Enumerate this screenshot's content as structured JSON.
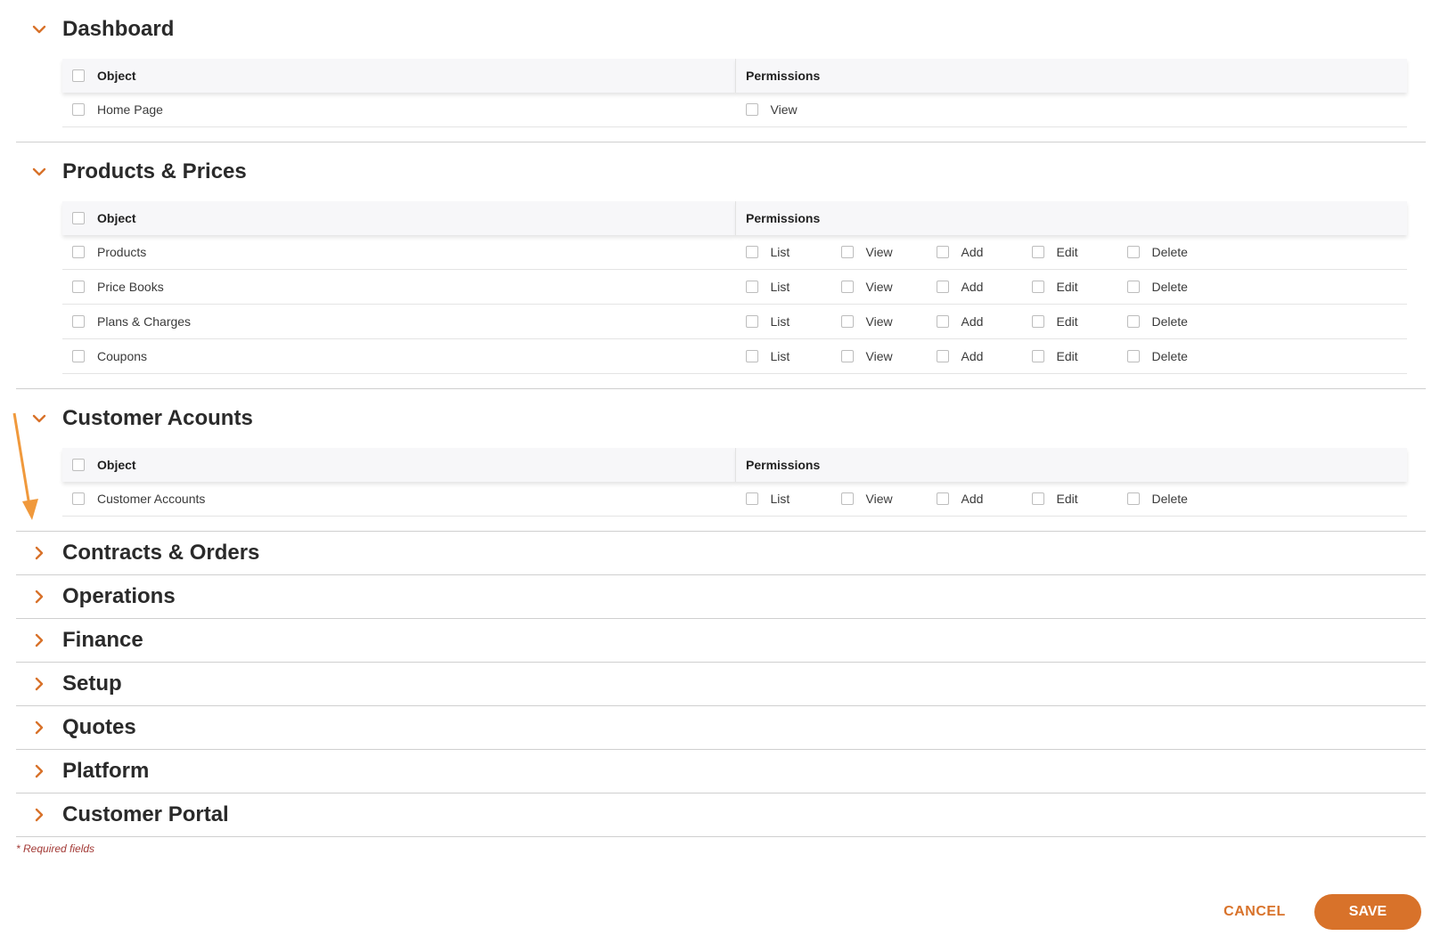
{
  "colors": {
    "accent": "#d8722a",
    "required": "#a33a36",
    "arrow": "#f0993c"
  },
  "table_headers": {
    "object": "Object",
    "permissions": "Permissions"
  },
  "sections": [
    {
      "title": "Dashboard",
      "expanded": true,
      "rows": [
        {
          "label": "Home Page",
          "permissions": [
            "View"
          ]
        }
      ]
    },
    {
      "title": "Products & Prices",
      "expanded": true,
      "rows": [
        {
          "label": "Products",
          "permissions": [
            "List",
            "View",
            "Add",
            "Edit",
            "Delete"
          ]
        },
        {
          "label": "Price Books",
          "permissions": [
            "List",
            "View",
            "Add",
            "Edit",
            "Delete"
          ]
        },
        {
          "label": "Plans & Charges",
          "permissions": [
            "List",
            "View",
            "Add",
            "Edit",
            "Delete"
          ]
        },
        {
          "label": "Coupons",
          "permissions": [
            "List",
            "View",
            "Add",
            "Edit",
            "Delete"
          ]
        }
      ]
    },
    {
      "title": "Customer Acounts",
      "expanded": true,
      "rows": [
        {
          "label": "Customer Accounts",
          "permissions": [
            "List",
            "View",
            "Add",
            "Edit",
            "Delete"
          ]
        }
      ]
    },
    {
      "title": "Contracts & Orders",
      "expanded": false
    },
    {
      "title": "Operations",
      "expanded": false
    },
    {
      "title": "Finance",
      "expanded": false
    },
    {
      "title": "Setup",
      "expanded": false
    },
    {
      "title": "Quotes",
      "expanded": false
    },
    {
      "title": "Platform",
      "expanded": false
    },
    {
      "title": "Customer Portal",
      "expanded": false
    }
  ],
  "footnote": "* Required fields",
  "actions": {
    "cancel": "CANCEL",
    "save": "SAVE"
  }
}
